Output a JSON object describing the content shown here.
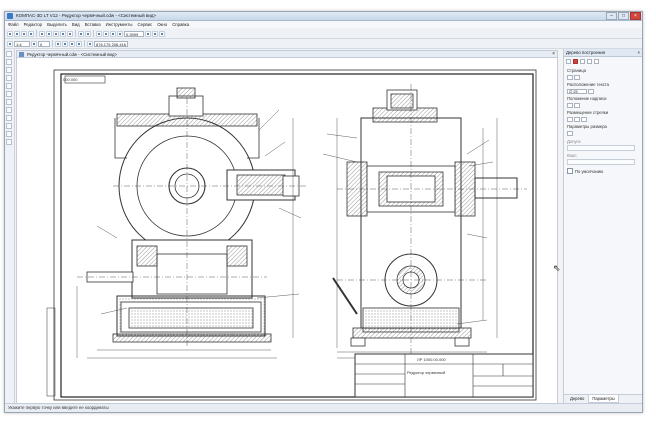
{
  "window": {
    "title": "КОМПАС-3D LT V12 - Редуктор червячный.cdw - <Системный вид>",
    "minimize": "–",
    "maximize": "□",
    "close": "×"
  },
  "menu": [
    "Файл",
    "Редактор",
    "Выделить",
    "Вид",
    "Вставка",
    "Инструменты",
    "Сервис",
    "Окно",
    "Справка"
  ],
  "toolbar": {
    "zoom_value": "0.3999",
    "layer_value": "0",
    "coords_value": "876.175  206.416",
    "view_value": "1:4"
  },
  "document_tab": {
    "label": "Редуктор червячный.cdw - <Системный вид>",
    "close": "×"
  },
  "drawing": {
    "stamp_label": "ЛР 1000.00.000",
    "title_block_name": "Редуктор червячный",
    "code_box": "000.000"
  },
  "right_panel": {
    "title": "Дерево построения",
    "sections": [
      {
        "label": "Страница"
      },
      {
        "label": "Расположение текста"
      },
      {
        "label": "Положение надписи"
      },
      {
        "label": "Размещение стрелки"
      },
      {
        "label": "Параметры размера"
      }
    ],
    "dropdown_value": "∅ 25",
    "field_labels": [
      "Допуск",
      "Квал"
    ],
    "checkbox_label": "По умолчанию",
    "tabs": [
      "Дерево",
      "Параметры"
    ]
  },
  "status": {
    "text": "Укажите первую точку или введите ее координаты"
  },
  "colors": {
    "accent": "#3b78c5",
    "drawing_line": "#333333",
    "hatch": "#555555"
  }
}
